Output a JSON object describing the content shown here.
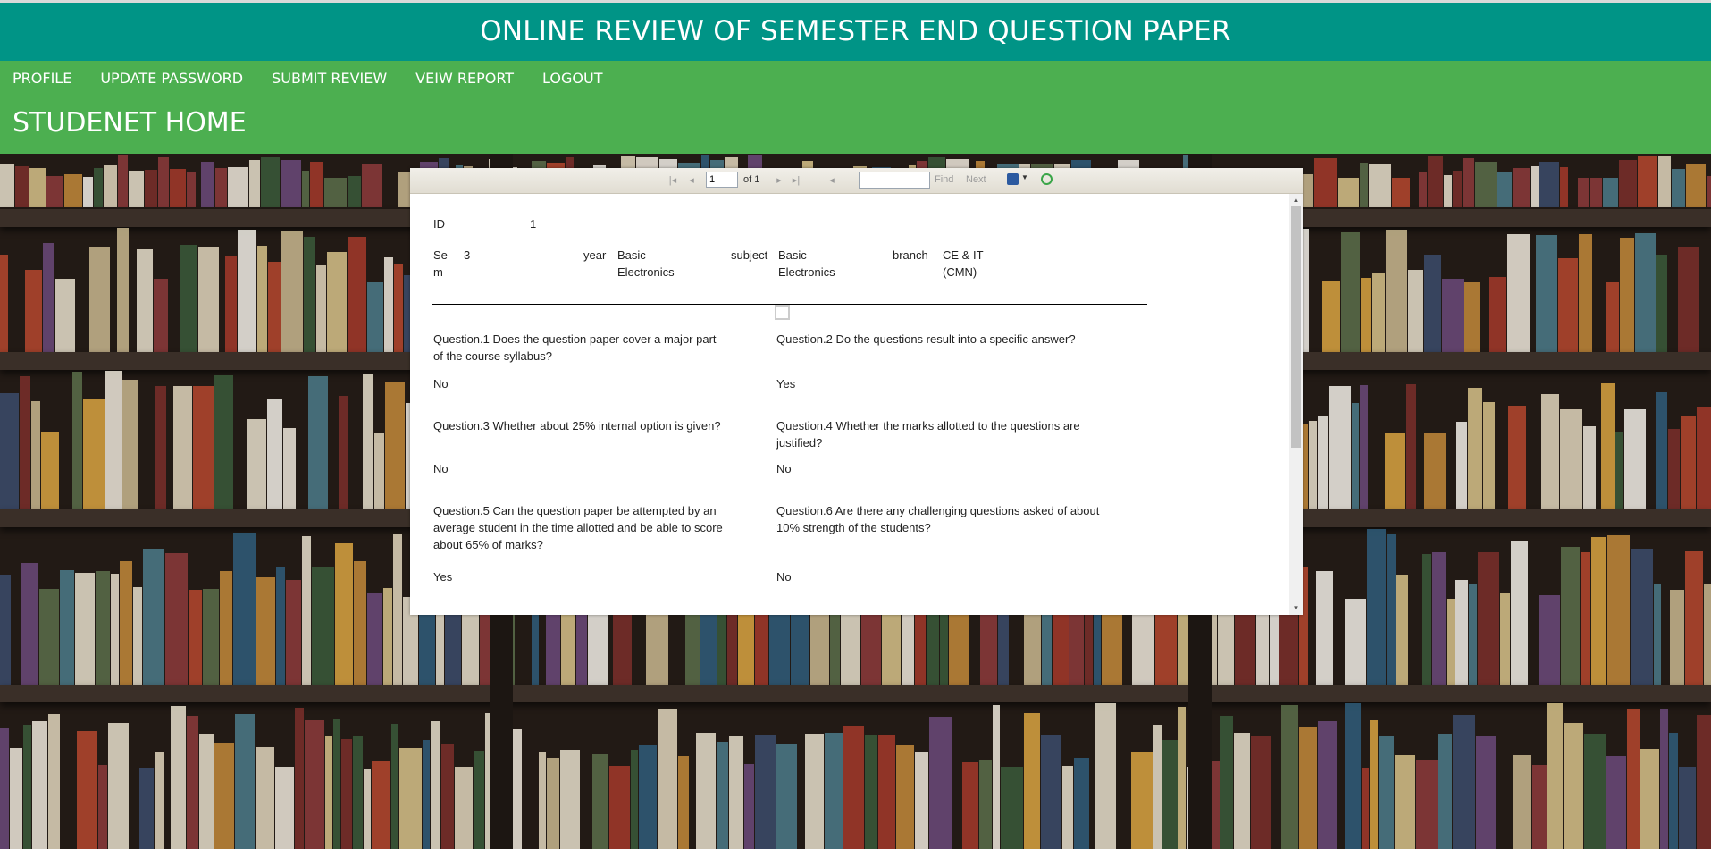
{
  "app": {
    "title": "ONLINE REVIEW OF SEMESTER END QUESTION PAPER"
  },
  "nav": {
    "items": [
      {
        "label": "PROFILE"
      },
      {
        "label": "UPDATE PASSWORD"
      },
      {
        "label": "SUBMIT REVIEW"
      },
      {
        "label": "VEIW REPORT"
      },
      {
        "label": "LOGOUT"
      }
    ]
  },
  "page": {
    "heading": "STUDENET HOME"
  },
  "viewer": {
    "toolbar": {
      "page_value": "1",
      "page_of": "of 1",
      "find_value": "",
      "find_label": "Find",
      "separator": "|",
      "next_label": "Next"
    },
    "report": {
      "id_label": "ID",
      "id_value": "1",
      "sem_label_1": "Se",
      "sem_label_2": "m",
      "sem_value": "3",
      "year_label": "year",
      "year_value_1": "Basic",
      "year_value_2": "Electronics",
      "subject_label": "subject",
      "subject_value_1": "Basic",
      "subject_value_2": "Electronics",
      "branch_label": "branch",
      "branch_value_1": "CE & IT",
      "branch_value_2": "(CMN)",
      "questions": [
        {
          "line1": "Question.1 Does the question paper cover a major part",
          "line2": "of the course syllabus?",
          "line3": "",
          "answer": "No"
        },
        {
          "line1": "Question.2 Do the questions result into a specific answer?",
          "line2": "",
          "line3": "",
          "answer": "Yes"
        },
        {
          "line1": "Question.3 Whether about 25% internal option is given?",
          "line2": "",
          "line3": "",
          "answer": "No"
        },
        {
          "line1": "Question.4 Whether the marks allotted to the questions are",
          "line2": "justified?",
          "line3": "",
          "answer": "No"
        },
        {
          "line1": "Question.5 Can the question paper be attempted by an",
          "line2": "average student in the time allotted and be able to score",
          "line3": "about 65% of marks?",
          "answer": "Yes"
        },
        {
          "line1": "Question.6 Are there any challenging questions asked of about",
          "line2": "10% strength of the students?",
          "line3": "",
          "answer": "No"
        }
      ]
    }
  },
  "colors": {
    "title_bar": "#009486",
    "nav_bar": "#4caf50"
  }
}
